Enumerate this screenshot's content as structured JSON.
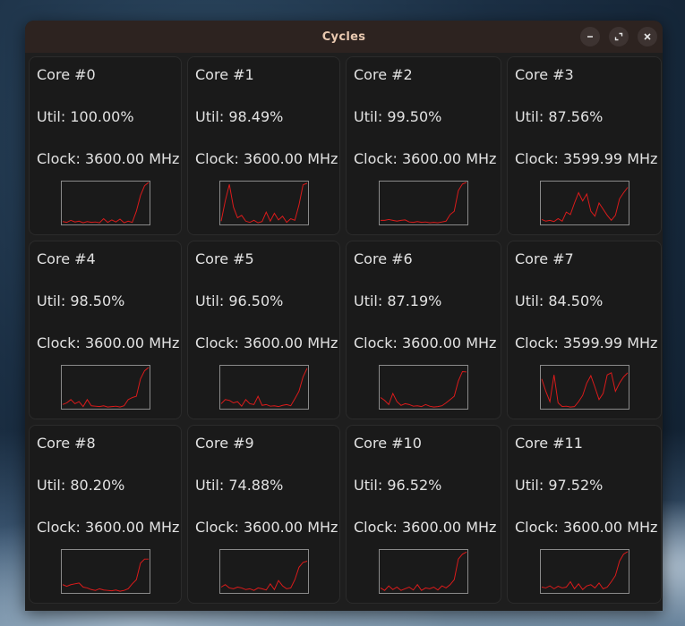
{
  "window": {
    "title": "Cycles"
  },
  "icons": {
    "minimize": "minimize-icon",
    "maximize": "maximize-icon",
    "close": "close-icon"
  },
  "colors": {
    "graph_line": "#e01b1b",
    "graph_border": "#8a8a8a"
  },
  "cores": [
    {
      "name": "Core #0",
      "util": "Util: 100.00%",
      "clock": "Clock: 3600.00 MHz",
      "history": [
        5,
        3,
        8,
        4,
        6,
        2,
        5,
        3,
        4,
        2,
        12,
        3,
        9,
        4,
        11,
        2,
        6,
        3,
        30,
        68,
        92,
        100
      ]
    },
    {
      "name": "Core #1",
      "util": "Util: 98.49%",
      "clock": "Clock: 3600.00 MHz",
      "history": [
        6,
        55,
        95,
        40,
        14,
        20,
        6,
        3,
        8,
        2,
        5,
        28,
        6,
        25,
        9,
        18,
        3,
        12,
        8,
        45,
        94,
        98
      ]
    },
    {
      "name": "Core #2",
      "util": "Util: 99.50%",
      "clock": "Clock: 3600.00 MHz",
      "history": [
        8,
        8,
        10,
        8,
        6,
        8,
        9,
        4,
        3,
        5,
        3,
        4,
        2,
        3,
        2,
        4,
        6,
        22,
        30,
        80,
        96,
        100
      ]
    },
    {
      "name": "Core #3",
      "util": "Util: 87.56%",
      "clock": "Clock: 3599.99 MHz",
      "history": [
        10,
        6,
        8,
        5,
        12,
        6,
        28,
        22,
        50,
        75,
        55,
        72,
        30,
        18,
        50,
        35,
        20,
        8,
        20,
        60,
        75,
        88
      ]
    },
    {
      "name": "Core #4",
      "util": "Util: 98.50%",
      "clock": "Clock: 3600.00 MHz",
      "history": [
        8,
        12,
        20,
        10,
        15,
        3,
        20,
        5,
        4,
        3,
        5,
        2,
        3,
        4,
        2,
        5,
        20,
        25,
        28,
        70,
        90,
        98
      ]
    },
    {
      "name": "Core #5",
      "util": "Util: 96.50%",
      "clock": "Clock: 3600.00 MHz",
      "history": [
        10,
        20,
        18,
        12,
        15,
        4,
        20,
        10,
        8,
        28,
        6,
        8,
        4,
        5,
        3,
        6,
        8,
        5,
        22,
        40,
        75,
        96
      ]
    },
    {
      "name": "Core #6",
      "util": "Util: 87.19%",
      "clock": "Clock: 3600.00 MHz",
      "history": [
        25,
        18,
        8,
        35,
        15,
        6,
        10,
        8,
        4,
        5,
        3,
        8,
        4,
        2,
        3,
        5,
        12,
        20,
        28,
        65,
        88,
        87
      ]
    },
    {
      "name": "Core #7",
      "util": "Util: 84.50%",
      "clock": "Clock: 3599.99 MHz",
      "history": [
        70,
        40,
        15,
        80,
        12,
        3,
        4,
        2,
        3,
        15,
        30,
        60,
        78,
        50,
        20,
        35,
        80,
        85,
        40,
        60,
        75,
        85
      ]
    },
    {
      "name": "Core #8",
      "util": "Util: 80.20%",
      "clock": "Clock: 3600.00 MHz",
      "history": [
        18,
        14,
        18,
        20,
        22,
        12,
        10,
        6,
        4,
        8,
        5,
        4,
        3,
        5,
        2,
        4,
        8,
        20,
        30,
        70,
        80,
        80
      ]
    },
    {
      "name": "Core #9",
      "util": "Util: 74.88%",
      "clock": "Clock: 3600.00 MHz",
      "history": [
        12,
        18,
        10,
        8,
        12,
        10,
        6,
        8,
        4,
        10,
        8,
        5,
        20,
        6,
        28,
        15,
        8,
        10,
        30,
        60,
        72,
        75
      ]
    },
    {
      "name": "Core #10",
      "util": "Util: 96.52%",
      "clock": "Clock: 3600.00 MHz",
      "history": [
        10,
        4,
        15,
        6,
        12,
        4,
        8,
        12,
        5,
        18,
        4,
        10,
        8,
        12,
        5,
        15,
        10,
        18,
        30,
        80,
        92,
        97
      ]
    },
    {
      "name": "Core #11",
      "util": "Util: 97.52%",
      "clock": "Clock: 3600.00 MHz",
      "history": [
        12,
        10,
        15,
        8,
        14,
        10,
        12,
        25,
        8,
        20,
        6,
        15,
        18,
        10,
        22,
        8,
        12,
        25,
        40,
        75,
        92,
        98
      ]
    }
  ]
}
